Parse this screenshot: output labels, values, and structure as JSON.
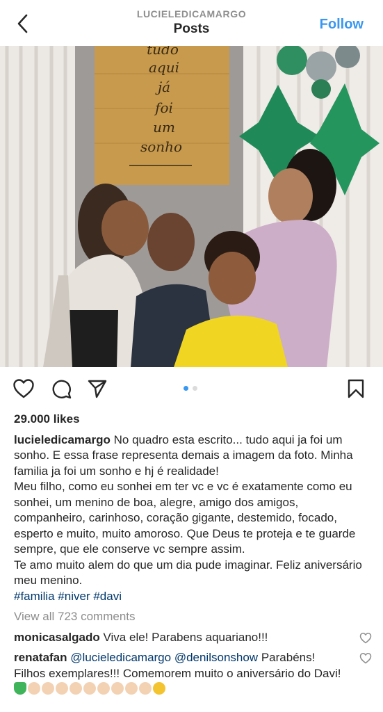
{
  "header": {
    "username": "LUCIELEDICAMARGO",
    "title": "Posts",
    "follow_label": "Follow"
  },
  "photo": {
    "board_text": [
      "tudo",
      "aqui",
      "já",
      "foi",
      "um",
      "sonho"
    ],
    "carousel_index": 1,
    "carousel_count": 2
  },
  "post": {
    "likes": "29.000 likes",
    "author": "lucieledicamargo",
    "caption_lines": [
      "No quadro esta escrito... tudo aqui ja foi um sonho. E essa frase representa demais a imagem da foto. Minha familia ja foi um sonho e hj é realidade!",
      "Meu filho, como eu sonhei em ter vc e vc é exatamente como eu sonhei, um menino de boa, alegre, amigo dos amigos, companheiro, carinhoso, coração gigante, destemido, focado, esperto e muito, muito amoroso.  Que Deus te proteja e te guarde sempre, que ele conserve vc sempre assim.",
      "Te amo muito alem do que um dia pude imaginar. Feliz aniversário meu menino."
    ],
    "hashtags": "#familia #niver #davi",
    "view_all": "View all 723 comments"
  },
  "comments": [
    {
      "user": "monicasalgado",
      "text": "Viva ele! Parabens aquariano!!!"
    },
    {
      "user": "renatafan",
      "mentions": "@lucieledicamargo @denilsonshow",
      "text": "Parabéns! Filhos exemplares!!! Comemorem muito o aniversário do Davi!"
    }
  ],
  "colors": {
    "accent": "#3897f0",
    "text": "#262626",
    "muted": "#8e8e8e",
    "link": "#00376b"
  }
}
